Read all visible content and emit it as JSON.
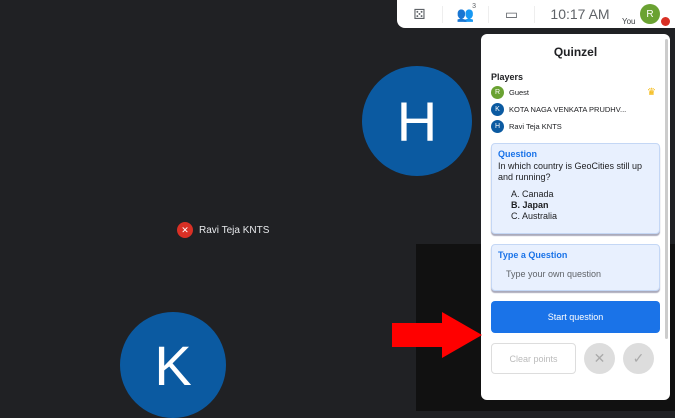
{
  "stage": {
    "tiles": [
      {
        "initial": "H"
      },
      {
        "initial": "K"
      }
    ],
    "name_chip": "Ravi Teja KNTS"
  },
  "topbar": {
    "participant_count": "3",
    "time": "10:17 AM",
    "you_label": "You",
    "you_initial": "R"
  },
  "panel": {
    "title": "Quinzel",
    "players_label": "Players",
    "players": [
      {
        "initial": "R",
        "name": "Guest",
        "color": "#6aa232",
        "host": true
      },
      {
        "initial": "K",
        "name": "KOTA NAGA VENKATA PRUDHV...",
        "color": "#0b5aa1"
      },
      {
        "initial": "H",
        "name": "Ravi Teja KNTS",
        "color": "#0b5aa1"
      }
    ],
    "question": {
      "heading": "Question",
      "text": "In which country is GeoCities still up and running?",
      "options": [
        "A. Canada",
        "B. Japan",
        "C. Australia"
      ]
    },
    "custom": {
      "heading": "Type a Question",
      "placeholder": "Type your own question"
    },
    "start_label": "Start question",
    "clear_label": "Clear points"
  }
}
